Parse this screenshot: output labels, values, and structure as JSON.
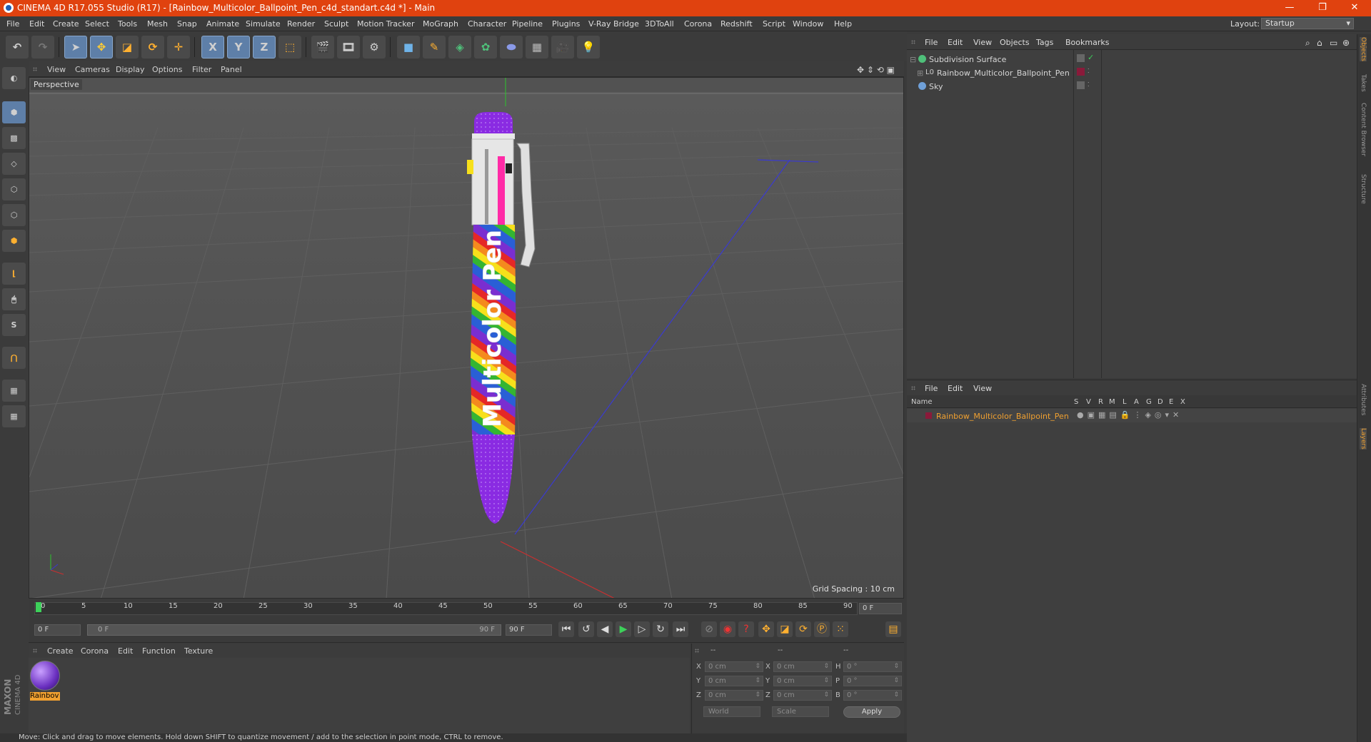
{
  "window": {
    "title": "CINEMA 4D R17.055 Studio (R17) - [Rainbow_Multicolor_Ballpoint_Pen_c4d_standart.c4d *] - Main",
    "controls": [
      "—",
      "❐",
      "✕"
    ]
  },
  "menubar": {
    "items": [
      "File",
      "Edit",
      "Create",
      "Select",
      "Tools",
      "Mesh",
      "Snap",
      "Animate",
      "Simulate",
      "Render",
      "Sculpt",
      "Motion Tracker",
      "MoGraph",
      "Character",
      "Pipeline",
      "Plugins",
      "V-Ray Bridge",
      "3DToAll",
      "Corona",
      "Redshift",
      "Script",
      "Window",
      "Help"
    ],
    "layout_label": "Layout:",
    "layout_value": "Startup"
  },
  "toolbar": {
    "axis_x": "X",
    "axis_y": "Y",
    "axis_z": "Z"
  },
  "viewport": {
    "menu": [
      "View",
      "Cameras",
      "Display",
      "Options",
      "Filter",
      "Panel"
    ],
    "camera_label": "Perspective",
    "grid_spacing": "Grid Spacing : 10 cm",
    "pen_text": "Multicolor Pen"
  },
  "timeline": {
    "ticks": [
      "0",
      "5",
      "10",
      "15",
      "20",
      "25",
      "30",
      "35",
      "40",
      "45",
      "50",
      "55",
      "60",
      "65",
      "70",
      "75",
      "80",
      "85",
      "90"
    ],
    "current_frame": "0 F"
  },
  "transport": {
    "start_field": "0 F",
    "range_start": "0 F",
    "range_end": "90 F",
    "end_field": "90 F"
  },
  "material_panel": {
    "menu": [
      "Create",
      "Corona",
      "Edit",
      "Function",
      "Texture"
    ],
    "material_name": "Rainbov"
  },
  "coordinates": {
    "headers": [
      "--",
      "--",
      "--"
    ],
    "rows": [
      {
        "l1": "X",
        "v1": "0 cm",
        "l2": "X",
        "v2": "0 cm",
        "l3": "H",
        "v3": "0 °"
      },
      {
        "l1": "Y",
        "v1": "0 cm",
        "l2": "Y",
        "v2": "0 cm",
        "l3": "P",
        "v3": "0 °"
      },
      {
        "l1": "Z",
        "v1": "0 cm",
        "l2": "Z",
        "v2": "0 cm",
        "l3": "B",
        "v3": "0 °"
      }
    ],
    "mode_world": "World",
    "mode_scale": "Scale",
    "apply": "Apply"
  },
  "status_bar": {
    "text": "Move: Click and drag to move elements. Hold down SHIFT to quantize movement / add to the selection in point mode, CTRL to remove."
  },
  "maxon_logo": {
    "line1": "MAXON",
    "line2": "CINEMA 4D"
  },
  "object_manager": {
    "menu": [
      "File",
      "Edit",
      "View",
      "Objects",
      "Tags",
      "Bookmarks"
    ],
    "objects": [
      {
        "name": "Subdivision Surface",
        "color": "#4fc07a"
      },
      {
        "name": "Rainbow_Multicolor_Ballpoint_Pen",
        "color": "#8a1a3a"
      },
      {
        "name": "Sky",
        "color": "#6fa0d8"
      }
    ]
  },
  "layer_manager": {
    "menu": [
      "File",
      "Edit",
      "View"
    ],
    "columns": [
      "Name",
      "S",
      "V",
      "R",
      "M",
      "L",
      "A",
      "G",
      "D",
      "E",
      "X"
    ],
    "layers": [
      {
        "name": "Rainbow_Multicolor_Ballpoint_Pen",
        "color": "#8a1a3a"
      }
    ]
  },
  "side_tabs": [
    "Objects",
    "Takes",
    "Content Browser",
    "Structure",
    "Attributes",
    "Layers"
  ],
  "colors": {
    "accent": "#e0420f",
    "selection": "#5e7fa8",
    "layer_highlight": "#f0a030"
  }
}
